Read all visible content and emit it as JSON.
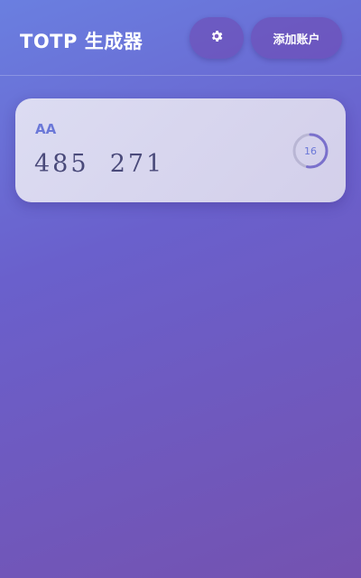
{
  "header": {
    "title": "TOTP 生成器",
    "settings_icon": "gear-icon",
    "add_account_label": "添加账户"
  },
  "accounts": [
    {
      "name": "AA",
      "code": "485  271",
      "seconds_remaining": "16",
      "period_fraction_remaining": 0.53
    }
  ],
  "colors": {
    "accent": "#6b78d8",
    "code_text": "#4a4a7a",
    "card_bg": "#d8d6ee"
  }
}
